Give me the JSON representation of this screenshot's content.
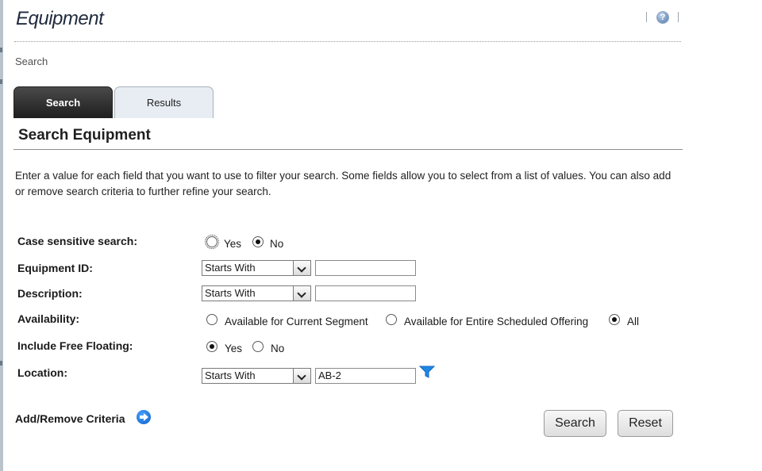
{
  "header": {
    "title": "Equipment",
    "breadcrumb": "Search"
  },
  "icons": {
    "help": "help-icon",
    "filter": "filter-icon",
    "add_remove": "arrow-right-circle-icon"
  },
  "tabs": [
    {
      "label": "Search",
      "active": true
    },
    {
      "label": "Results",
      "active": false
    }
  ],
  "section": {
    "title": "Search Equipment",
    "intro": "Enter a value for each field that you want to use to filter your search. Some fields allow you to select from a list of values. You can also add or remove search criteria to further refine your search."
  },
  "form": {
    "case_sensitive": {
      "label": "Case sensitive search:",
      "options": [
        "Yes",
        "No"
      ],
      "selected": "No"
    },
    "equipment_id": {
      "label": "Equipment ID:",
      "operator": "Starts With",
      "value": ""
    },
    "description": {
      "label": "Description:",
      "operator": "Starts With",
      "value": ""
    },
    "availability": {
      "label": "Availability:",
      "options": [
        "Available for Current Segment",
        "Available for Entire Scheduled Offering",
        "All"
      ],
      "selected": "All"
    },
    "include_free_floating": {
      "label": "Include Free Floating:",
      "options": [
        "Yes",
        "No"
      ],
      "selected": "Yes"
    },
    "location": {
      "label": "Location:",
      "operator": "Starts With",
      "value": "AB-2"
    }
  },
  "footer": {
    "add_remove_label": "Add/Remove Criteria",
    "search_button": "Search",
    "reset_button": "Reset"
  },
  "colors": {
    "tab_active": "#2b2b2b",
    "tab_inactive": "#e7edf3",
    "link_icon": "#1a73d9",
    "filter_icon": "#1e88e5"
  }
}
